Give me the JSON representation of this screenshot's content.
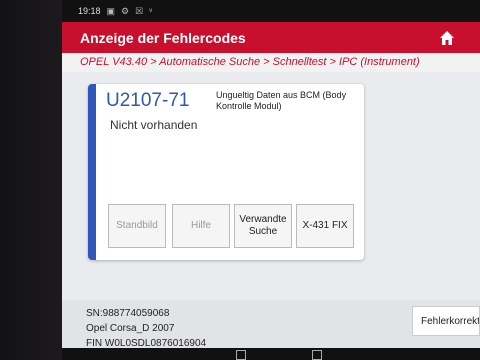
{
  "status_bar": {
    "time": "19:18",
    "icons": [
      "image-icon",
      "settings-icon",
      "box-icon",
      "signal-icon"
    ]
  },
  "header": {
    "title": "Anzeige der Fehlercodes",
    "home_icon": "home-icon"
  },
  "breadcrumb": "OPEL V43.40 > Automatische Suche > Schnelltest > IPC (Instrument)",
  "fault": {
    "code": "U2107-71",
    "status": "Nicht vorhanden",
    "description": "Ungueltig Daten aus BCM (Body Kontrolle Modul)"
  },
  "buttons": {
    "standbild": "Standbild",
    "hilfe": "Hilfe",
    "verwandte": "Verwandte Suche",
    "x431fix": "X-431 FIX"
  },
  "vehicle": {
    "sn": "SN:988774059068",
    "model": "Opel Corsa_D 2007",
    "fin": "FIN W0L0SDL0876016904"
  },
  "footer_button": "Fehlerkorrekt",
  "colors": {
    "accent_red": "#c8102e",
    "accent_blue": "#2f56b8"
  }
}
